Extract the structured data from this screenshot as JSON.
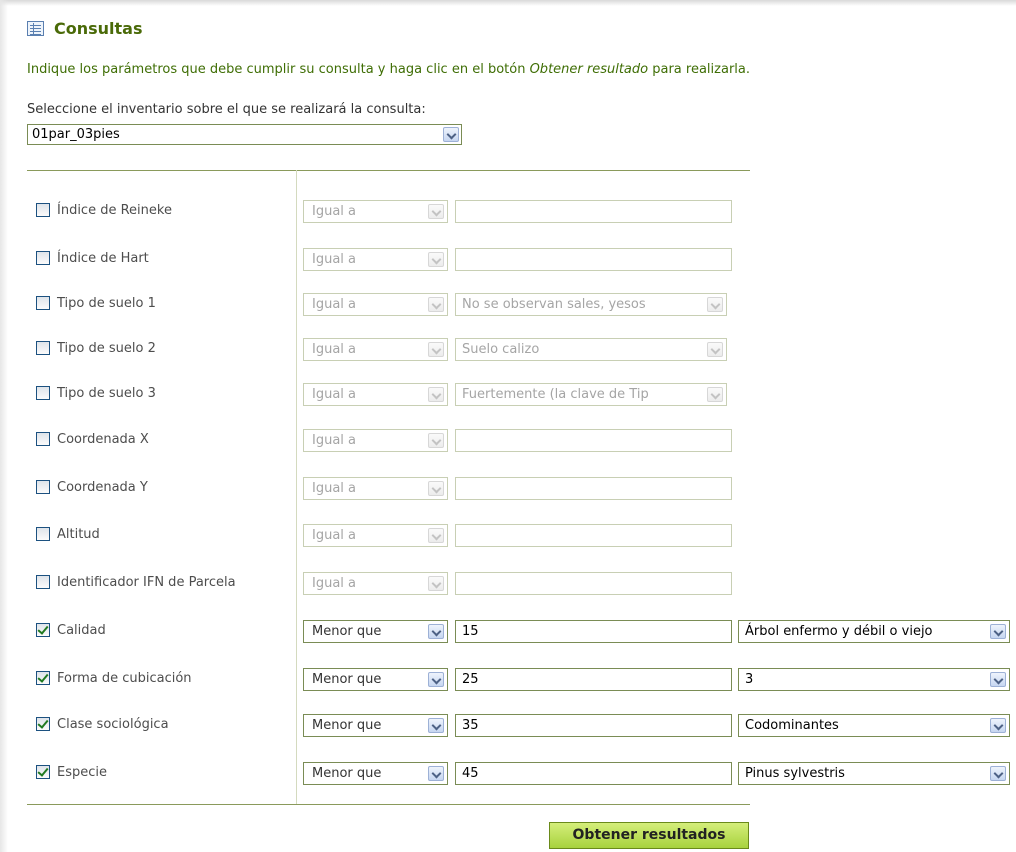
{
  "title": "Consultas",
  "intro": {
    "before": "Indique los parámetros que debe cumplir su consulta y haga clic en el botón ",
    "emphasis": "Obtener resultado",
    "after": " para realizarla."
  },
  "inventory": {
    "label": "Seleccione el inventario sobre el que se realizará la consulta:",
    "selected": "01par_03pies"
  },
  "rows": [
    {
      "label": "Índice de Reineke",
      "checked": false,
      "operator": "Igual a",
      "value": ""
    },
    {
      "label": "Índice de Hart",
      "checked": false,
      "operator": "Igual a",
      "value": ""
    },
    {
      "label": "Tipo de suelo 1",
      "checked": false,
      "operator": "Igual a",
      "value_select": "No se observan sales, yesos"
    },
    {
      "label": "Tipo de suelo 2",
      "checked": false,
      "operator": "Igual a",
      "value_select": "Suelo calizo"
    },
    {
      "label": "Tipo de suelo 3",
      "checked": false,
      "operator": "Igual a",
      "value_select": "Fuertemente (la clave de Tip"
    },
    {
      "label": "Coordenada X",
      "checked": false,
      "operator": "Igual a",
      "value": ""
    },
    {
      "label": "Coordenada Y",
      "checked": false,
      "operator": "Igual a",
      "value": ""
    },
    {
      "label": "Altitud",
      "checked": false,
      "operator": "Igual a",
      "value": ""
    },
    {
      "label": "Identificador IFN de Parcela",
      "checked": false,
      "operator": "Igual a",
      "value": ""
    },
    {
      "label": "Calidad",
      "checked": true,
      "operator": "Menor que",
      "value": "15",
      "extra": "Árbol enfermo y débil o viejo"
    },
    {
      "label": "Forma de cubicación",
      "checked": true,
      "operator": "Menor que",
      "value": "25",
      "extra": "3"
    },
    {
      "label": "Clase sociológica",
      "checked": true,
      "operator": "Menor que",
      "value": "35",
      "extra": "Codominantes"
    },
    {
      "label": "Especie",
      "checked": true,
      "operator": "Menor que",
      "value": "45",
      "extra": "Pinus sylvestris"
    }
  ],
  "submit_label": "Obtener resultados"
}
